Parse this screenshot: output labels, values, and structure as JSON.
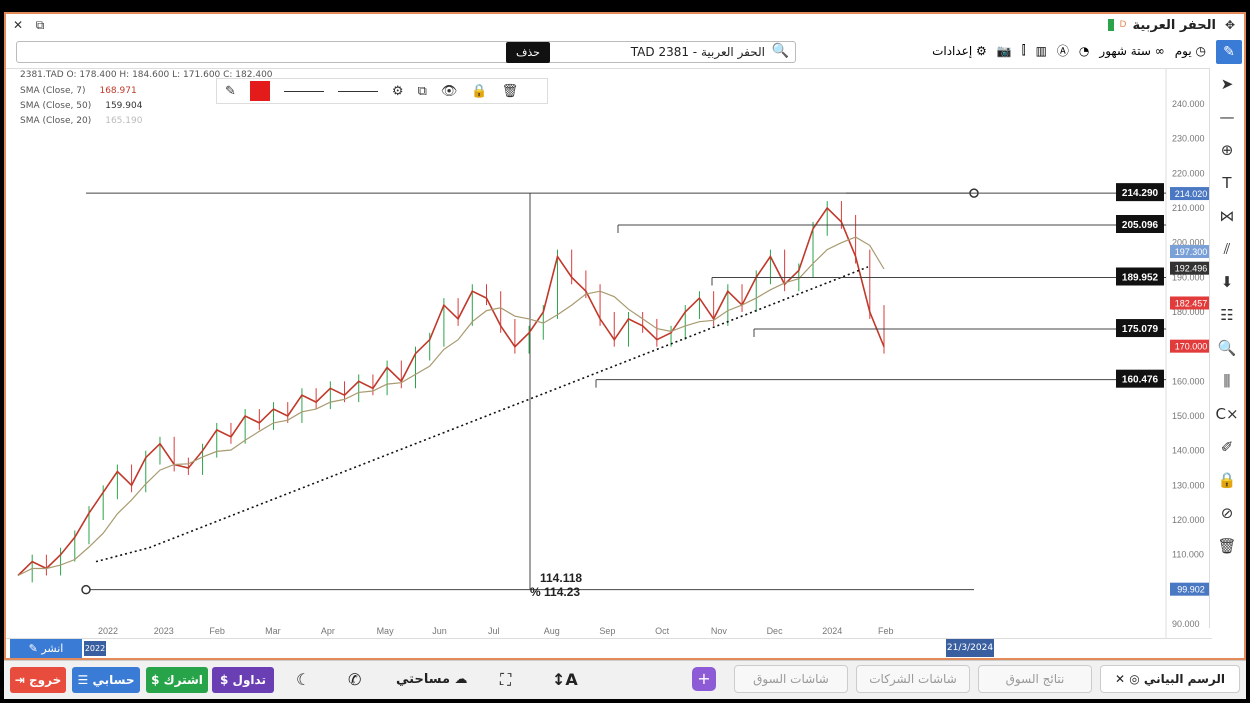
{
  "window": {
    "title": "الحفر العربية",
    "title_badge": "D"
  },
  "toolbar": {
    "symbol": "TAD 2381 - الحفر العربية",
    "settings": "إعدادات",
    "range": "ستة شهور",
    "interval": "يوم",
    "tooltip": "حذف"
  },
  "legend": {
    "ohlc": "2381.TAD   O: 178.400  H: 184.600  L: 171.600  C: 182.400",
    "sma7": "SMA  (Close, 7)",
    "sma7_val": "168.971",
    "sma50": "SMA  (Close, 50)",
    "sma50_val": "159.904",
    "sma20": "SMA  (Close, 20)",
    "sma20_val": "165.190"
  },
  "chart_data": {
    "type": "line",
    "y_ticks": [
      "240.000",
      "230.000",
      "220.000",
      "210.000",
      "200.000",
      "190.000",
      "180.000",
      "170.000",
      "160.000",
      "150.000",
      "140.000",
      "130.000",
      "120.000",
      "110.000",
      "100.000",
      "90.000"
    ],
    "x_ticks": [
      "2022",
      "2023",
      "Feb",
      "Mar",
      "Apr",
      "May",
      "Jun",
      "Jul",
      "Aug",
      "Sep",
      "Oct",
      "Nov",
      "Dec",
      "2024",
      "Feb"
    ],
    "levels": [
      {
        "label": "214.290",
        "value": 214.29
      },
      {
        "label": "205.096",
        "value": 205.096
      },
      {
        "label": "189.952",
        "value": 189.952
      },
      {
        "label": "175.079",
        "value": 175.079
      },
      {
        "label": "160.476",
        "value": 160.476
      }
    ],
    "price_tags": [
      {
        "label": "214.020",
        "value": 214.02,
        "color": "#4a78c2"
      },
      {
        "label": "197.300",
        "value": 197.3,
        "color": "#7aa0d8"
      },
      {
        "label": "192.496",
        "value": 192.496,
        "color": "#333333"
      },
      {
        "label": "182.457",
        "value": 182.457,
        "color": "#e23b3b"
      },
      {
        "label": "170.000",
        "value": 170.0,
        "color": "#e23b3b"
      },
      {
        "label": "99.902",
        "value": 99.902,
        "color": "#4a78c2"
      }
    ],
    "measure": {
      "value": "114.118",
      "percent": "% 114.23"
    },
    "price_series": [
      104,
      108,
      106,
      110,
      115,
      122,
      128,
      134,
      130,
      138,
      142,
      136,
      135,
      140,
      146,
      144,
      150,
      148,
      152,
      150,
      156,
      154,
      158,
      156,
      160,
      158,
      164,
      160,
      168,
      172,
      182,
      178,
      186,
      184,
      176,
      170,
      174,
      180,
      196,
      190,
      186,
      178,
      172,
      178,
      176,
      172,
      174,
      180,
      184,
      178,
      186,
      182,
      190,
      196,
      188,
      192,
      204,
      210,
      206,
      196,
      180,
      170
    ],
    "sma_dotted": [
      108,
      110,
      112,
      115,
      118,
      121,
      124,
      127,
      130,
      133,
      136,
      139,
      142,
      145,
      148,
      151,
      154,
      157,
      160,
      163,
      166,
      169,
      172,
      175,
      178,
      181,
      184,
      187,
      190,
      193
    ]
  },
  "time_bar": {
    "share": "انشر",
    "date_left": "2022",
    "date_right": "21/3/2024"
  },
  "bottom": {
    "chart_tab": "الرسم البياني",
    "market_results": "نتائج السوق",
    "company_screens": "شاشات الشركات",
    "market_screens": "شاشات السوق",
    "my_space": "مساحتي",
    "trade": "تداول",
    "subscribe": "اشترك",
    "account": "حسابي",
    "logout": "خروج"
  },
  "colors": {
    "accent": "#3a7bd5",
    "candle_up": "#2ba34a",
    "candle_down": "#d93c3c",
    "border": "#e28a5a"
  }
}
